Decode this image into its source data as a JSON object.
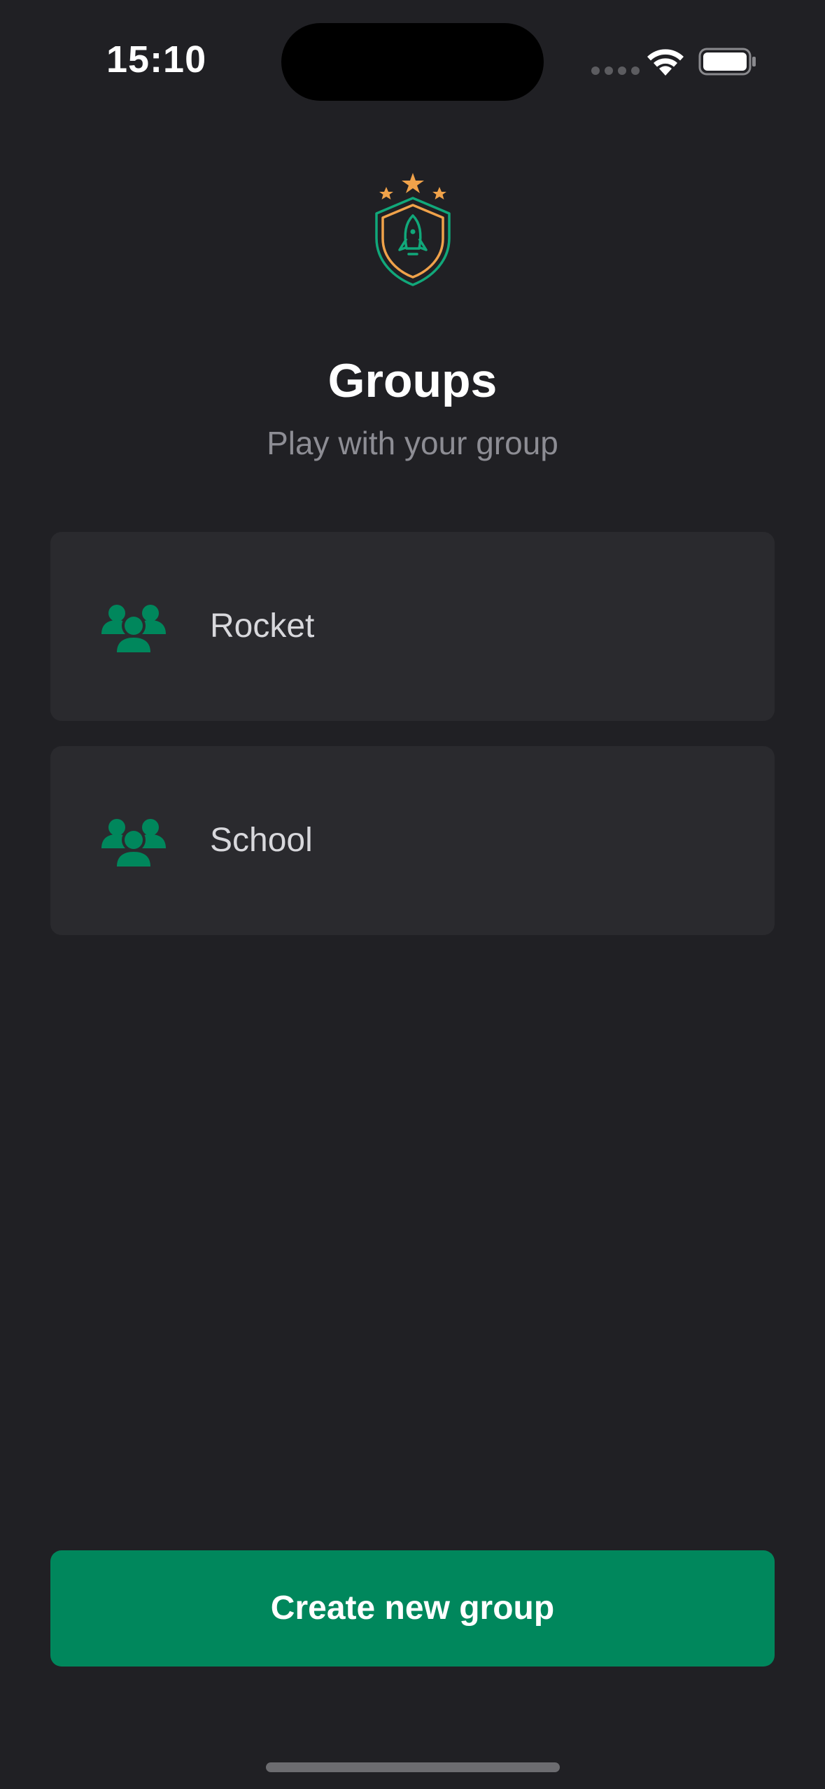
{
  "status_bar": {
    "time": "15:10",
    "icons": [
      "cellular-signal-icon",
      "wifi-icon",
      "battery-icon"
    ]
  },
  "header": {
    "logo_icon": "shield-rocket-stars-icon",
    "title": "Groups",
    "subtitle": "Play with your group"
  },
  "groups": [
    {
      "label": "Rocket",
      "icon": "group-people-icon"
    },
    {
      "label": "School",
      "icon": "group-people-icon"
    }
  ],
  "actions": {
    "create_label": "Create new group"
  },
  "colors": {
    "background": "#202024",
    "card": "#2a2a2e",
    "accent_green": "#00875c",
    "accent_orange": "#f0a24a",
    "subtitle_gray": "#8d8d94"
  }
}
